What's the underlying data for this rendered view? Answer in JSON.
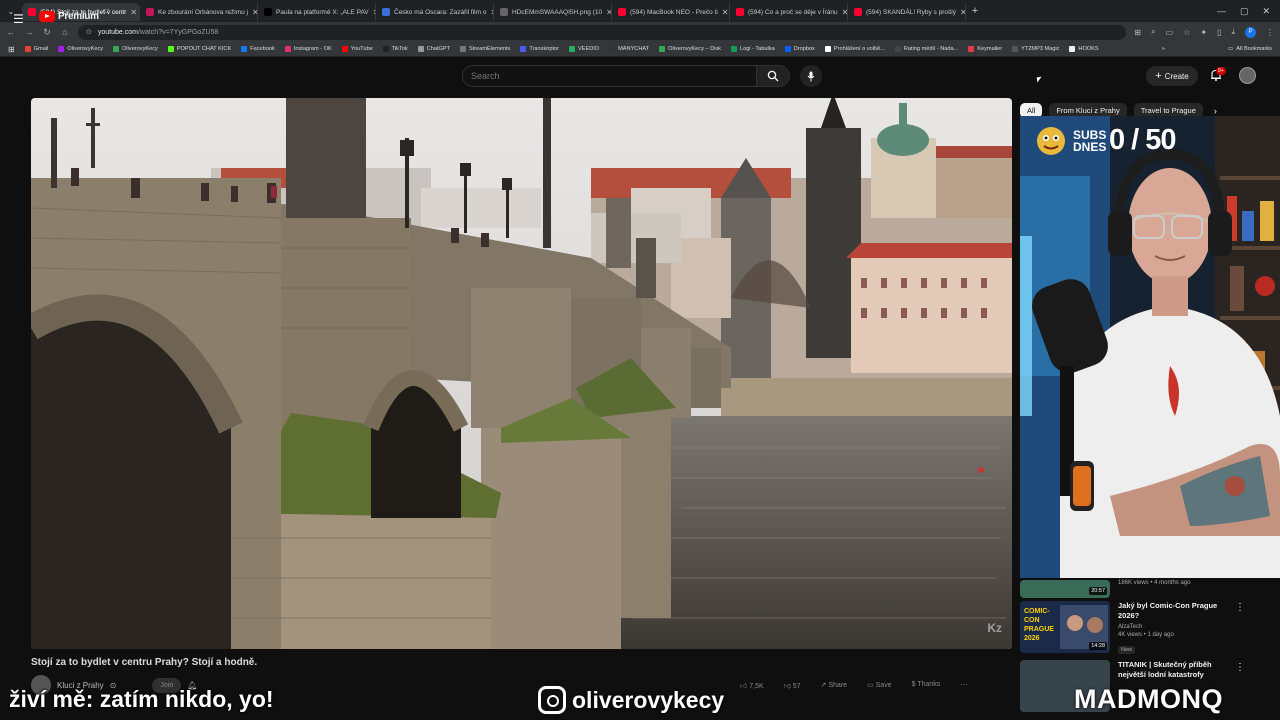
{
  "browser": {
    "tabs": [
      {
        "label": "(594) Stojí za to bydlet v centr",
        "active": true,
        "color": "#ff0033"
      },
      {
        "label": "Ke zbourání Orbánova režimu j",
        "active": false,
        "color": "#c2185b"
      },
      {
        "label": "Paula na platformě X: „ALE PAV",
        "active": false,
        "color": "#000000"
      },
      {
        "label": "Česko má Oscara: Zazářil film o",
        "active": false,
        "color": "#3b6fd8"
      },
      {
        "label": "HDcEMmSWAAAQI5H.png (10",
        "active": false,
        "color": "#666666"
      },
      {
        "label": "(594) MacBook NEO - Prečo ti",
        "active": false,
        "color": "#ff0033"
      },
      {
        "label": "(594) Co a proč se děje v Íránu",
        "active": false,
        "color": "#ff0033"
      },
      {
        "label": "(594) SKANDÁL! Ryby s prošlý",
        "active": false,
        "color": "#ff0033"
      }
    ],
    "url_host": "youtube.com",
    "url_path": "/watch?v=7YyGPGoZU58",
    "bookmarks": [
      {
        "label": "Gmail",
        "color": "#ea4335"
      },
      {
        "label": "OliverovyKecy",
        "color": "#a020f0"
      },
      {
        "label": "OliverovyKecy",
        "color": "#36a852"
      },
      {
        "label": "POPOUT CHAT KICK",
        "color": "#53fc18"
      },
      {
        "label": "Facebook",
        "color": "#1877f2"
      },
      {
        "label": "Instagram - OK",
        "color": "#e1306c"
      },
      {
        "label": "YouTube",
        "color": "#ff0000"
      },
      {
        "label": "TikTok",
        "color": "#222222"
      },
      {
        "label": "ChatGPT",
        "color": "#999999"
      },
      {
        "label": "StreamElements",
        "color": "#777777"
      },
      {
        "label": "Transkriptor",
        "color": "#4a5cff"
      },
      {
        "label": "VEEDIO",
        "color": "#27ae60"
      },
      {
        "label": "MANYCHAT",
        "color": "#333333"
      },
      {
        "label": "OliverovyKecy – Disk",
        "color": "#34a853"
      },
      {
        "label": "Logi - Tabulka",
        "color": "#0f9d58"
      },
      {
        "label": "Dropbox",
        "color": "#0061ff"
      },
      {
        "label": "Prohlášení o volbě...",
        "color": "#ffffff"
      },
      {
        "label": "Rating médií - Nada...",
        "color": "#444444"
      },
      {
        "label": "Keymailer",
        "color": "#e63946"
      },
      {
        "label": "YT2MP3 Magic",
        "color": "#555555"
      },
      {
        "label": "HOOKS",
        "color": "#eeeeee"
      }
    ],
    "all_bookmarks": "All Bookmarks",
    "profile_initial": "P"
  },
  "header": {
    "logo_text": "Premium",
    "logo_country": "CZ",
    "search_placeholder": "Search",
    "create_label": "Create",
    "notification_count": "9+"
  },
  "video": {
    "watermark": "Kz",
    "title": "Stojí za to bydlet v centru Prahy? Stojí a hodně.",
    "channel": "Kluci z Prahy",
    "subscribe": "Join",
    "likes": "7,5K",
    "dislikes": "57",
    "share": "Share",
    "save": "Save",
    "thanks": "Thanks"
  },
  "chips": [
    "All",
    "From Kluci z Prahy",
    "Travel to Prague"
  ],
  "overlay": {
    "subs_label": "SUBS DNES",
    "subs_count": "0 / 50",
    "left_text": "živí mě: zatím nikdo, yo!",
    "instagram": "oliverovykecy",
    "brand": "MADMONQ"
  },
  "related": [
    {
      "duration": "20:57",
      "title": "",
      "channel": "",
      "stats": "186K views • 4 months ago",
      "new": ""
    },
    {
      "duration": "14:28",
      "title": "Jaký byl Comic-Con Prague 2026?",
      "channel": "AlzaTech",
      "stats": "4K views • 1 day ago",
      "new": "New",
      "thumb_text": "COMIC-CON PRAGUE 2026"
    },
    {
      "duration": "",
      "title": "TITANIK | Skutečný příběh největší lodní katastrofy",
      "channel": "",
      "stats": "",
      "new": ""
    }
  ]
}
